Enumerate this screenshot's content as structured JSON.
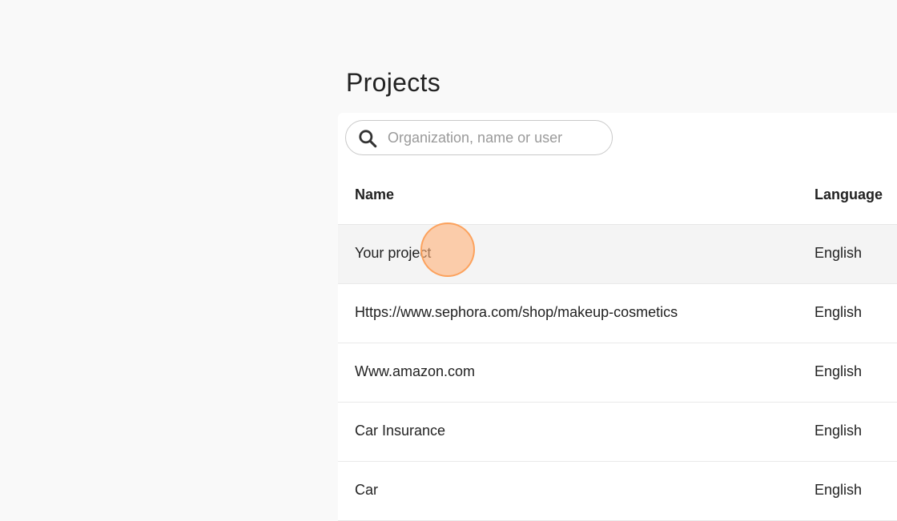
{
  "page": {
    "title": "Projects"
  },
  "search": {
    "placeholder": "Organization, name or user",
    "value": "",
    "icon": "search-icon"
  },
  "table": {
    "columns": {
      "name": "Name",
      "language": "Language"
    },
    "rows": [
      {
        "name": "Your project",
        "language": "English"
      },
      {
        "name": "Https://www.sephora.com/shop/makeup-cosmetics",
        "language": "English"
      },
      {
        "name": "Www.amazon.com",
        "language": "English"
      },
      {
        "name": "Car Insurance",
        "language": "English"
      },
      {
        "name": "Car",
        "language": "English"
      }
    ]
  },
  "colors": {
    "background": "#f9f9f9",
    "panel": "#ffffff",
    "hover_row": "#f4f4f4",
    "click_marker": "#ffb078"
  }
}
